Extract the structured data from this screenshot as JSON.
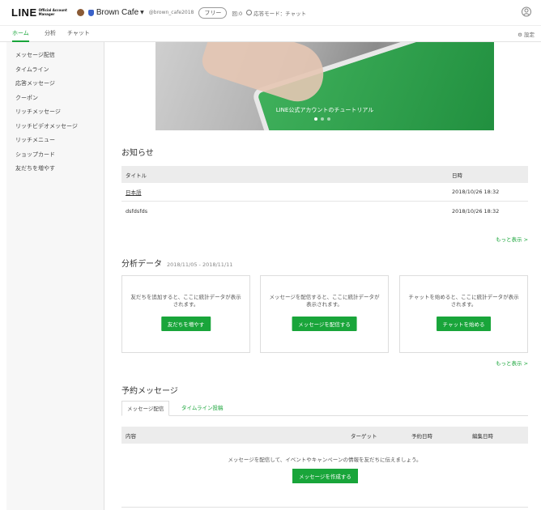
{
  "header": {
    "logo": "LINE",
    "logo_sub": [
      "Official Account",
      "Manager"
    ],
    "account_name": "Brown Cafe",
    "account_id": "@brown_cafe2018",
    "plan": "フリー",
    "count": "回:0",
    "mode": "応答モード：チャット"
  },
  "tabs": [
    {
      "label": "ホーム"
    },
    {
      "label": "分析"
    },
    {
      "label": "チャット"
    }
  ],
  "settings_label": "⚙ 設定",
  "sidebar": {
    "items": [
      {
        "label": "メッセージ配信"
      },
      {
        "label": "タイムライン"
      },
      {
        "label": "応答メッセージ"
      },
      {
        "label": "クーポン"
      },
      {
        "label": "リッチメッセージ"
      },
      {
        "label": "リッチビデオメッセージ"
      },
      {
        "label": "リッチメニュー"
      },
      {
        "label": "ショップカード"
      },
      {
        "label": "友だちを増やす"
      }
    ]
  },
  "hero": {
    "caption": "LINE公式アカウントのチュートリアル"
  },
  "news": {
    "title": "お知らせ",
    "col_title": "タイトル",
    "col_date": "日時",
    "rows": [
      {
        "title": "日本語",
        "date": "2018/10/26 18:32"
      },
      {
        "title": "dsfdsfds",
        "date": "2018/10/26 18:32"
      }
    ],
    "more": "もっと表示 >"
  },
  "analytics": {
    "title": "分析データ",
    "range": "2018/11/05 - 2018/11/11",
    "cards": [
      {
        "text": "友だちを追加すると、ここに統計データが表示されます。",
        "button": "友だちを増やす"
      },
      {
        "text": "メッセージを配信すると、ここに統計データが表示されます。",
        "button": "メッセージを配信する"
      },
      {
        "text": "チャットを始めると、ここに統計データが表示されます。",
        "button": "チャットを始める"
      }
    ],
    "more": "もっと表示 >"
  },
  "scheduled": {
    "title": "予約メッセージ",
    "tabs": [
      {
        "label": "メッセージ配信"
      },
      {
        "label": "タイムライン投稿"
      }
    ],
    "col_content": "内容",
    "col_target": "ターゲット",
    "col_scheduled": "予約日時",
    "col_edited": "編集日時",
    "empty_text": "メッセージを配信して、イベントやキャンペーンの情報を友だちに伝えましょう。",
    "create_button": "メッセージを作成する"
  },
  "colors": {
    "accent": "#19a53a"
  }
}
